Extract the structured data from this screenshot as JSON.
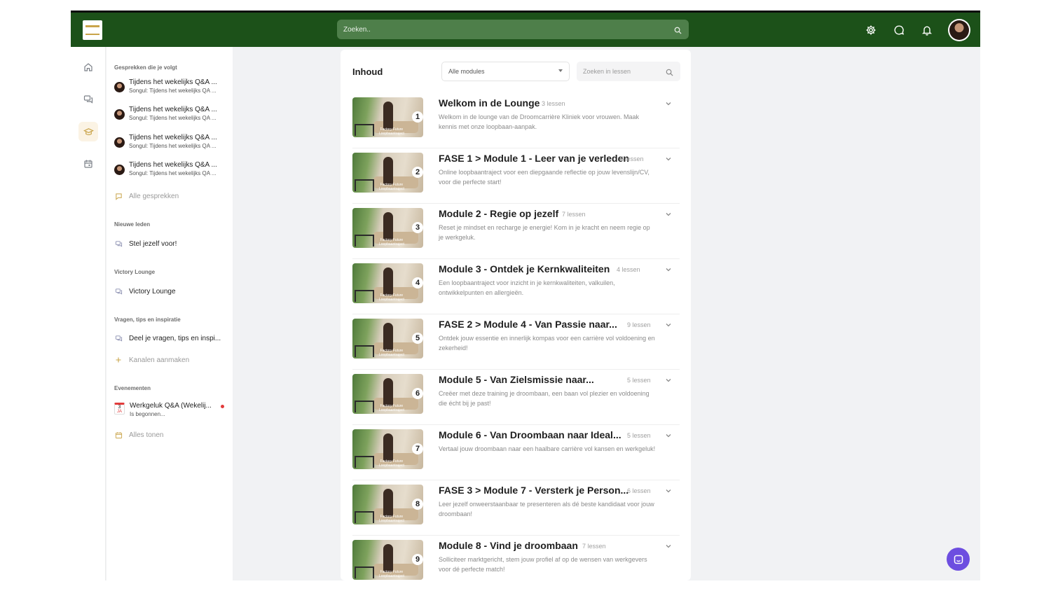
{
  "header": {
    "search_placeholder": "Zoeken..",
    "icons": [
      "gear-icon",
      "chat-bubble-icon",
      "bell-icon",
      "avatar"
    ]
  },
  "rail": {
    "items": [
      "home-icon",
      "messages-icon",
      "graduation-cap-icon",
      "calendar-icon"
    ],
    "active": "graduation-cap-icon"
  },
  "sidebar": {
    "followed_title": "Gesprekken die je volgt",
    "conversations": [
      {
        "title": "Tijdens het wekelijks Q&A ...",
        "subtitle": "Songul: Tijdens het wekelijks QA ..."
      },
      {
        "title": "Tijdens het wekelijks Q&A ...",
        "subtitle": "Songul: Tijdens het wekelijks QA ..."
      },
      {
        "title": "Tijdens het wekelijks Q&A ...",
        "subtitle": "Songul: Tijdens het wekelijks QA ..."
      },
      {
        "title": "Tijdens het wekelijks Q&A ...",
        "subtitle": "Songul: Tijdens het wekelijks QA ..."
      }
    ],
    "all_conversations": "Alle gesprekken",
    "new_members_title": "Nieuwe leden",
    "new_members_link": "Stel jezelf voor!",
    "victory_title": "Victory Lounge",
    "victory_link": "Victory Lounge",
    "questions_title": "Vragen, tips en inspiratie",
    "questions_link": "Deel je vragen, tips en inspi...",
    "create_channels": "Kanalen aanmaken",
    "events_title": "Evenementen",
    "event": {
      "day": "3",
      "month": "JA",
      "title": "Werkgeluk Q&A (Wekelij...",
      "subtitle": "Is begonnen..."
    },
    "show_all": "Alles tonen"
  },
  "content": {
    "title": "Inhoud",
    "modules_select": "Alle modules",
    "lesson_search_placeholder": "Zoeken in lessen",
    "thumb_caption_1": "Factory Future",
    "thumb_caption_2": "Loopbaantraject",
    "modules": [
      {
        "num": "1",
        "title": "Welkom in de Lounge",
        "count": "3 lessen",
        "desc": "Welkom in de lounge van de Droomcarrière Kliniek voor vrouwen. Maak kennis met onze loopbaan-aanpak."
      },
      {
        "num": "2",
        "title": "FASE 1 > Module 1 - Leer van je verleden",
        "count": "5 lessen",
        "desc": "Online loopbaantraject voor een diepgaande reflectie op jouw levenslijn/CV, voor die perfecte start!"
      },
      {
        "num": "3",
        "title": "Module 2 - Regie op jezelf",
        "count": "7 lessen",
        "desc": "Reset je mindset en recharge je energie! Kom in je kracht en neem regie op je werkgeluk."
      },
      {
        "num": "4",
        "title": "Module 3 - Ontdek je Kernkwaliteiten",
        "count": "4 lessen",
        "desc": "Een loopbaantraject voor inzicht in je kernkwaliteiten, valkuilen, ontwikkelpunten en allergieën."
      },
      {
        "num": "5",
        "title": "FASE 2 > Module 4 - Van Passie naar...",
        "count": "9 lessen",
        "desc": "Ontdek jouw essentie en innerlijk kompas voor een carrière vol voldoening en zekerheid!"
      },
      {
        "num": "6",
        "title": "Module 5 - Van Zielsmissie naar...",
        "count": "5 lessen",
        "desc": "Creëer met deze training je droombaan, een baan vol plezier en voldoening die écht bij je past!"
      },
      {
        "num": "7",
        "title": "Module 6 - Van Droombaan naar Ideal...",
        "count": "5 lessen",
        "desc": "Vertaal jouw droombaan naar een haalbare carrière vol kansen en werkgeluk!"
      },
      {
        "num": "8",
        "title": "FASE 3 > Module 7 - Versterk je Person...",
        "count": "6 lessen",
        "desc": "Leer jezelf onweerstaanbaar te presenteren als dé beste kandidaat voor jouw droombaan!"
      },
      {
        "num": "9",
        "title": "Module 8 - Vind je droombaan",
        "count": "7 lessen",
        "desc": "Solliciteer marktgericht, stem jouw profiel af op de wensen van werkgevers voor dé perfecte match!"
      }
    ]
  },
  "colors": {
    "topbar": "#1c5119",
    "accent": "#c9a44a",
    "fab": "#6d4ee0"
  }
}
